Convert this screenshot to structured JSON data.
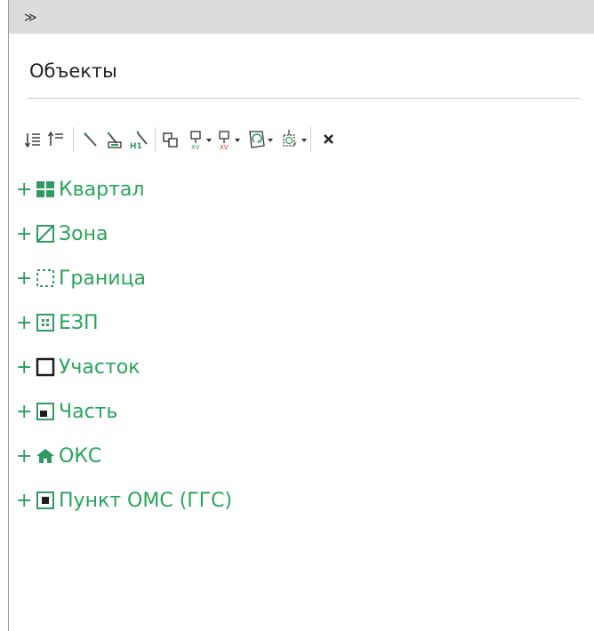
{
  "header": {
    "expand_glyph": "≫"
  },
  "panel": {
    "title": "Объекты"
  },
  "toolbar": {
    "buttons": [
      {
        "name": "sort-down-icon"
      },
      {
        "name": "sort-up-icon"
      },
      {
        "name": "magic-wand-icon"
      },
      {
        "name": "magic-wand-select-icon"
      },
      {
        "name": "magic-wand-h-icon"
      },
      {
        "name": "group-icon"
      },
      {
        "name": "import-xv-green-icon"
      },
      {
        "name": "import-xv-red-icon"
      },
      {
        "name": "polygon-refresh-icon"
      },
      {
        "name": "target-xy-icon"
      },
      {
        "name": "close-icon"
      }
    ]
  },
  "tree": {
    "items": [
      {
        "plus": "+",
        "label": "Квартал"
      },
      {
        "plus": "+",
        "label": "Зона"
      },
      {
        "plus": "+",
        "label": "Граница"
      },
      {
        "plus": "+",
        "label": "ЕЗП"
      },
      {
        "plus": "+",
        "label": "Участок"
      },
      {
        "plus": "+",
        "label": "Часть"
      },
      {
        "plus": "+",
        "label": "ОКС"
      },
      {
        "plus": "+",
        "label": "Пункт ОМС (ГГС)"
      }
    ]
  },
  "colors": {
    "accent": "#28a45a",
    "icon": "#2f9b62",
    "text": "#222222",
    "strip": "#dcdcdc"
  }
}
